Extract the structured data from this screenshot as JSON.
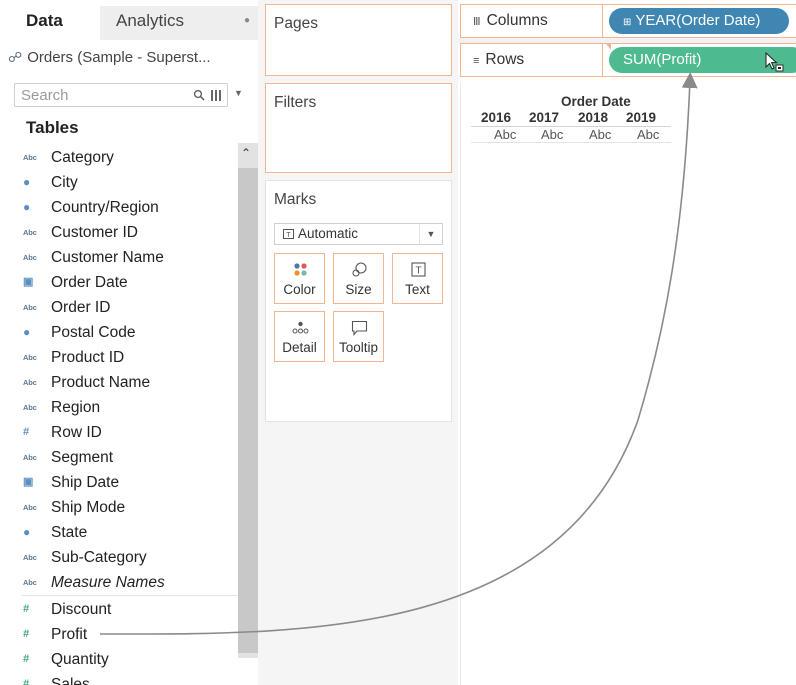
{
  "left_pane": {
    "tabs": [
      {
        "label": "Data",
        "active": true
      },
      {
        "label": "Analytics",
        "active": false
      }
    ],
    "datasource": "Orders (Sample - Superst...",
    "search": {
      "placeholder": "Search"
    },
    "tables_heading": "Tables",
    "fields": [
      {
        "label": "Category",
        "icon": "abc-icon",
        "role": "dimension"
      },
      {
        "label": "City",
        "icon": "globe-icon",
        "role": "dimension"
      },
      {
        "label": "Country/Region",
        "icon": "globe-icon",
        "role": "dimension"
      },
      {
        "label": "Customer ID",
        "icon": "abc-icon",
        "role": "dimension"
      },
      {
        "label": "Customer Name",
        "icon": "abc-icon",
        "role": "dimension"
      },
      {
        "label": "Order Date",
        "icon": "calendar-icon",
        "role": "dimension"
      },
      {
        "label": "Order ID",
        "icon": "abc-icon",
        "role": "dimension"
      },
      {
        "label": "Postal Code",
        "icon": "globe-icon",
        "role": "dimension"
      },
      {
        "label": "Product ID",
        "icon": "abc-icon",
        "role": "dimension"
      },
      {
        "label": "Product Name",
        "icon": "abc-icon",
        "role": "dimension"
      },
      {
        "label": "Region",
        "icon": "abc-icon",
        "role": "dimension"
      },
      {
        "label": "Row ID",
        "icon": "hash-icon",
        "role": "dimension"
      },
      {
        "label": "Segment",
        "icon": "abc-icon",
        "role": "dimension"
      },
      {
        "label": "Ship Date",
        "icon": "calendar-icon",
        "role": "dimension"
      },
      {
        "label": "Ship Mode",
        "icon": "abc-icon",
        "role": "dimension"
      },
      {
        "label": "State",
        "icon": "globe-icon",
        "role": "dimension"
      },
      {
        "label": "Sub-Category",
        "icon": "abc-icon",
        "role": "dimension"
      },
      {
        "label": "Measure Names",
        "icon": "abc-icon",
        "role": "dimension",
        "italic": true
      },
      {
        "label": "Discount",
        "icon": "measure-hash-icon",
        "role": "measure"
      },
      {
        "label": "Profit",
        "icon": "measure-hash-icon",
        "role": "measure"
      },
      {
        "label": "Quantity",
        "icon": "measure-hash-icon",
        "role": "measure"
      },
      {
        "label": "Sales",
        "icon": "measure-hash-icon",
        "role": "measure"
      }
    ]
  },
  "cards": {
    "pages": "Pages",
    "filters": "Filters",
    "marks": {
      "title": "Marks",
      "mark_type": "Automatic",
      "buttons": {
        "color": "Color",
        "size": "Size",
        "text": "Text",
        "detail": "Detail",
        "tooltip": "Tooltip"
      }
    }
  },
  "shelves": {
    "columns": {
      "label": "Columns",
      "pill": "YEAR(Order Date)"
    },
    "rows": {
      "label": "Rows",
      "pill": "SUM(Profit)"
    }
  },
  "view": {
    "header_title": "Order Date",
    "years": [
      "2016",
      "2017",
      "2018",
      "2019"
    ],
    "cells": [
      "Abc",
      "Abc",
      "Abc",
      "Abc"
    ]
  },
  "colors": {
    "shelf_border": "#f0b693",
    "dimension_pill": "#3f87b2",
    "measure_pill": "#4dbb8f",
    "drag_arrow": "#8a8a8a"
  }
}
